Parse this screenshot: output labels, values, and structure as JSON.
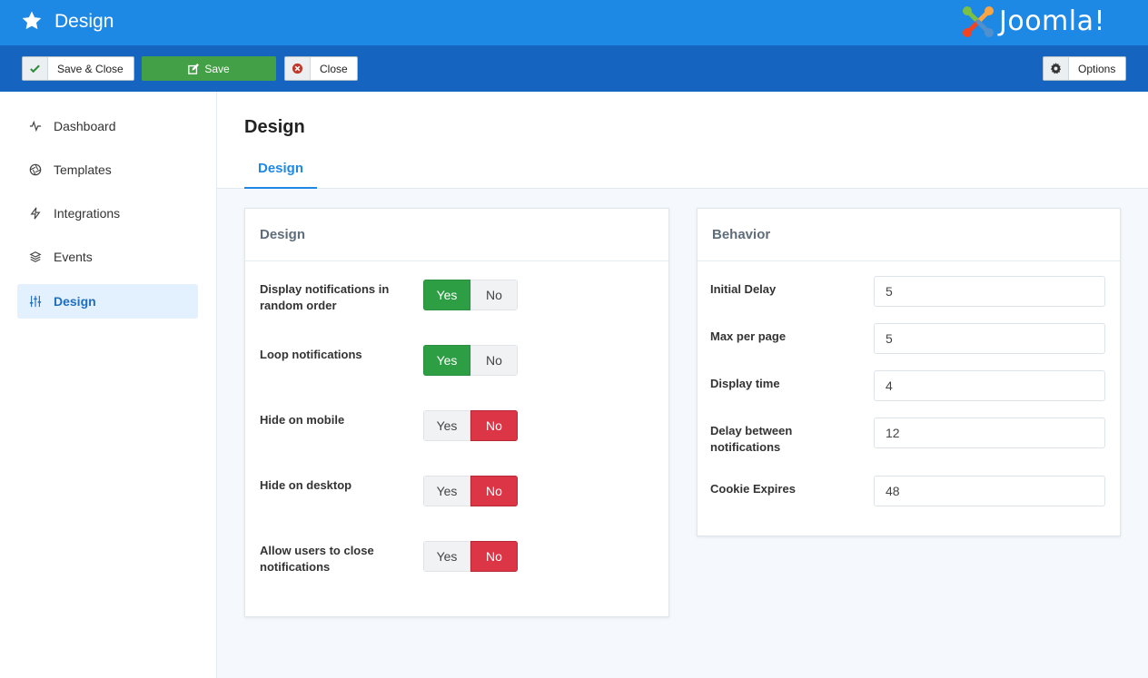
{
  "header": {
    "title": "Design",
    "logo_text": "Joomla!"
  },
  "toolbar": {
    "save_close_label": "Save & Close",
    "save_label": "Save",
    "close_label": "Close",
    "options_label": "Options"
  },
  "sidebar": {
    "items": [
      {
        "label": "Dashboard",
        "icon": "activity-icon",
        "active": false
      },
      {
        "label": "Templates",
        "icon": "aperture-icon",
        "active": false
      },
      {
        "label": "Integrations",
        "icon": "lightning-icon",
        "active": false
      },
      {
        "label": "Events",
        "icon": "layers-icon",
        "active": false
      },
      {
        "label": "Design",
        "icon": "sliders-icon",
        "active": true
      }
    ]
  },
  "main": {
    "page_title": "Design",
    "tabs": [
      {
        "label": "Design",
        "active": true
      }
    ],
    "design_card": {
      "title": "Design",
      "fields": [
        {
          "label": "Display notifications in random order",
          "yes": "Yes",
          "no": "No",
          "value": "Yes"
        },
        {
          "label": "Loop notifications",
          "yes": "Yes",
          "no": "No",
          "value": "Yes"
        },
        {
          "label": "Hide on mobile",
          "yes": "Yes",
          "no": "No",
          "value": "No"
        },
        {
          "label": "Hide on desktop",
          "yes": "Yes",
          "no": "No",
          "value": "No"
        },
        {
          "label": "Allow users to close notifications",
          "yes": "Yes",
          "no": "No",
          "value": "No"
        }
      ]
    },
    "behavior_card": {
      "title": "Behavior",
      "fields": [
        {
          "label": "Initial Delay",
          "value": "5"
        },
        {
          "label": "Max per page",
          "value": "5"
        },
        {
          "label": "Display time",
          "value": "4"
        },
        {
          "label": "Delay between notifications",
          "value": "12"
        },
        {
          "label": "Cookie Expires",
          "value": "48"
        }
      ]
    }
  },
  "colors": {
    "header_blue": "#1e88e5",
    "toolbar_blue": "#1565c0",
    "yes_green": "#2e9e44",
    "no_red": "#dc3545",
    "active_blue": "#1e6fbf"
  }
}
